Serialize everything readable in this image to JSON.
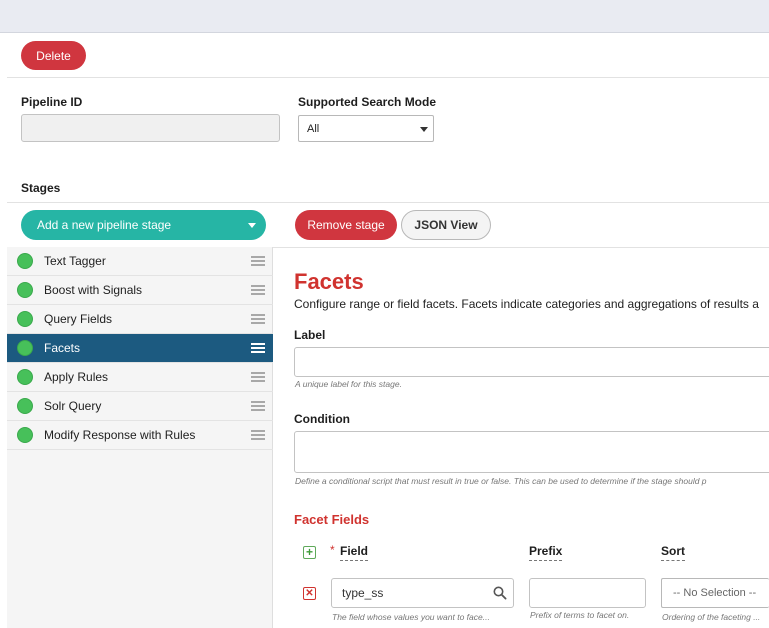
{
  "toolbar": {
    "delete_label": "Delete"
  },
  "pipeline": {
    "id_label": "Pipeline ID",
    "id_value": "",
    "mode_label": "Supported Search Mode",
    "mode_value": "All"
  },
  "stages": {
    "heading": "Stages",
    "add_label": "Add a new pipeline stage",
    "items": [
      {
        "label": "Text Tagger"
      },
      {
        "label": "Boost with Signals"
      },
      {
        "label": "Query Fields"
      },
      {
        "label": "Facets"
      },
      {
        "label": "Apply Rules"
      },
      {
        "label": "Solr Query"
      },
      {
        "label": "Modify Response with Rules"
      }
    ],
    "active_index": 3
  },
  "actions": {
    "remove_label": "Remove stage",
    "json_label": "JSON View"
  },
  "editor": {
    "title": "Facets",
    "description": "Configure range or field facets. Facets indicate categories and aggregations of results a",
    "label_label": "Label",
    "label_value": "",
    "label_help": "A unique label for this stage.",
    "condition_label": "Condition",
    "condition_value": "",
    "condition_help": "Define a conditional script that must result in true or false. This can be used to determine if the stage should p",
    "facet_fields": {
      "title": "Facet Fields",
      "required_mark": "*",
      "field_header": "Field",
      "prefix_header": "Prefix",
      "sort_header": "Sort",
      "row": {
        "field_value": "type_ss",
        "field_help": "The field whose values you want to face...",
        "prefix_value": "",
        "prefix_help": "Prefix of terms to facet on.",
        "sort_value": "-- No Selection --",
        "sort_help": "Ordering of the faceting ..."
      }
    }
  },
  "colors": {
    "accent_red": "#d0363f",
    "teal": "#26b5a5",
    "active_stage": "#1c5a80",
    "status_green": "#47c05a"
  },
  "icons": {
    "stage_status": "green-circle-icon",
    "drag": "drag-handle-icon",
    "search": "search-icon",
    "add_row": "plus-box-icon",
    "remove_row": "x-box-icon"
  }
}
